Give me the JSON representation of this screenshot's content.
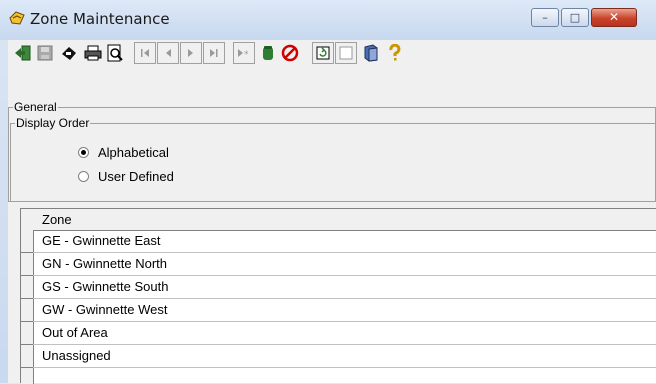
{
  "window": {
    "title": "Zone Maintenance",
    "minimize_glyph": "–",
    "maximize_glyph": "□",
    "close_glyph": "✕"
  },
  "toolbar": {
    "buttons": [
      {
        "name": "exit",
        "icon": "exit-door-icon",
        "enabled": true
      },
      {
        "name": "save",
        "icon": "save-disk-icon",
        "enabled": false
      },
      {
        "name": "print-setup",
        "icon": "print-setup-icon",
        "enabled": true
      },
      {
        "name": "print",
        "icon": "printer-icon",
        "enabled": true
      },
      {
        "name": "print-preview",
        "icon": "print-preview-icon",
        "enabled": true
      },
      {
        "name": "first-record",
        "icon": "first-record-icon",
        "enabled": false
      },
      {
        "name": "previous-record",
        "icon": "previous-record-icon",
        "enabled": false
      },
      {
        "name": "next-record",
        "icon": "next-record-icon",
        "enabled": false
      },
      {
        "name": "last-record",
        "icon": "last-record-icon",
        "enabled": false
      },
      {
        "name": "new-record",
        "icon": "new-record-icon",
        "enabled": false
      },
      {
        "name": "delete-record",
        "icon": "delete-record-icon",
        "enabled": true
      },
      {
        "name": "cancel",
        "icon": "cancel-icon",
        "enabled": true
      },
      {
        "name": "refresh",
        "icon": "refresh-icon",
        "enabled": true
      },
      {
        "name": "blank",
        "icon": "blank-page-icon",
        "enabled": true
      },
      {
        "name": "book",
        "icon": "book-icon",
        "enabled": true
      },
      {
        "name": "help",
        "icon": "help-icon",
        "enabled": true
      }
    ]
  },
  "general": {
    "label": "General",
    "display_order": {
      "label": "Display Order",
      "options": [
        {
          "label": "Alphabetical",
          "selected": true
        },
        {
          "label": "User Defined",
          "selected": false
        }
      ]
    }
  },
  "grid": {
    "columns": [
      "Zone"
    ],
    "rows": [
      "GE - Gwinnette East",
      "GN - Gwinnette North",
      "GS - Gwinnette South",
      "GW - Gwinnette West",
      "Out of Area",
      "Unassigned"
    ]
  },
  "colors": {
    "title_bar": "#c7d8ef",
    "client_bg": "#f0f0f0",
    "close_button": "#c8432b",
    "delete_icon": "#2e7d32",
    "cancel_icon": "#d00000"
  }
}
